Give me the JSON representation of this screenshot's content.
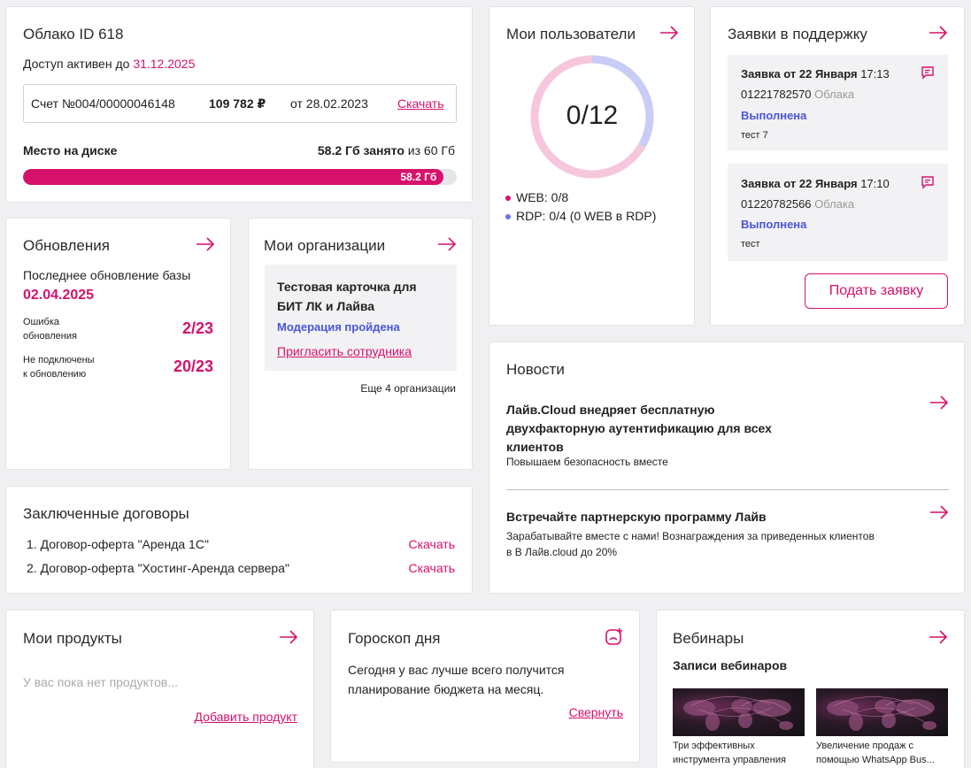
{
  "cloud": {
    "title": "Облако ID 618",
    "access_prefix": "Доступ активен до",
    "access_date": "31.12.2025",
    "invoice": {
      "number": "Счет №004/00000046148",
      "amount": "109 782 ₽",
      "date": "от 28.02.2023",
      "download": "Скачать"
    },
    "disk": {
      "label": "Место на диске",
      "used_text": "58.2 Гб занято",
      "total_text": "из 60 Гб",
      "bar_label": "58.2 Гб",
      "used_gb": 58.2,
      "total_gb": 60
    }
  },
  "users": {
    "title": "Мои пользователи",
    "center": "0/12",
    "web": "WEB: 0/8",
    "rdp": "RDP: 0/4 (0 WEB в RDP)",
    "web_used": 0,
    "web_total": 8,
    "rdp_used": 0,
    "rdp_total": 4
  },
  "support": {
    "title": "Заявки в поддержку",
    "tickets": [
      {
        "title": "Заявка от 22 Января",
        "time": "17:13",
        "number": "01221782570",
        "category": "Облака",
        "status": "Выполнена",
        "text": "тест 7"
      },
      {
        "title": "Заявка от 22 Января",
        "time": "17:10",
        "number": "01220782566",
        "category": "Облака",
        "status": "Выполнена",
        "text": "тест"
      }
    ],
    "submit": "Подать заявку"
  },
  "updates": {
    "title": "Обновления",
    "last_label": "Последнее обновление базы",
    "last_date": "02.04.2025",
    "error_label_1": "Ошибка",
    "error_label_2": "обновления",
    "error_value": "2/23",
    "nc_label_1": "Не подключены",
    "nc_label_2": "к обновлению",
    "nc_value": "20/23"
  },
  "orgs": {
    "title": "Мои организации",
    "org_name_1": "Тестовая карточка для",
    "org_name_2": "БИТ ЛК и Лайва",
    "status": "Модерация пройдена",
    "invite": "Пригласить сотрудника",
    "more": "Еще 4 организации"
  },
  "news": {
    "title": "Новости",
    "items": [
      {
        "line1": "Лайв.Cloud внедряет бесплатную",
        "line2": "двухфакторную аутентификацию для всех",
        "line3": "клиентов",
        "sub": "Повышаем безопасность вместе"
      },
      {
        "line1": "Встречайте партнерскую программу Лайв",
        "sub1": "Зарабатывайте вместе с нами! Вознаграждения за приведенных клиентов",
        "sub2": "в В Лайв.cloud до 20%"
      }
    ]
  },
  "contracts": {
    "title": "Заключенные договоры",
    "items": [
      {
        "name": "1. Договор-оферта \"Аренда 1С\"",
        "download": "Скачать"
      },
      {
        "name": "2. Договор-оферта \"Хостинг-Аренда сервера\"",
        "download": "Скачать"
      }
    ]
  },
  "products": {
    "title": "Мои продукты",
    "empty": "У вас пока нет продуктов...",
    "add": "Добавить продукт"
  },
  "horoscope": {
    "title": "Гороскоп дня",
    "text1": "Сегодня у вас лучше всего получится",
    "text2": "планирование бюджета на месяц.",
    "collapse": "Свернуть"
  },
  "webinars": {
    "title": "Вебинары",
    "subtitle": "Записи вебинаров",
    "items": [
      {
        "line1": "Три эффективных",
        "line2": "инструмента управления"
      },
      {
        "line1": "Увеличение продаж с",
        "line2": "помощью WhatsApp Bus..."
      }
    ]
  },
  "colors": {
    "accent": "#d6116c",
    "ring_pink": "#f6c6dc",
    "ring_blue": "#c9cdf6",
    "status_blue": "#4a55d8"
  },
  "icons": [
    "arrow-right-icon",
    "chat-icon",
    "horoscope-icon"
  ]
}
